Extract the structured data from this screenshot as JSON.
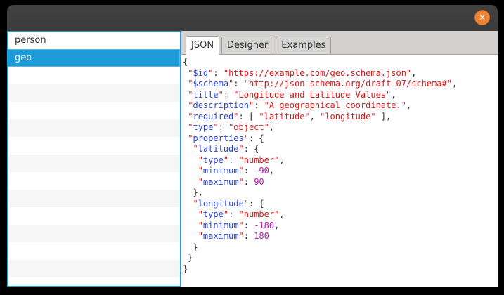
{
  "window": {
    "titlebar": {
      "title": "",
      "close_icon": "✕"
    },
    "colors": {
      "titlebar": "#3b3b3b",
      "close_button": "#ee8233",
      "background": "#000000"
    }
  },
  "sidebar": {
    "items": [
      {
        "label": "person",
        "selected": false
      },
      {
        "label": "geo",
        "selected": true
      }
    ],
    "empty_rows": 13,
    "colors": {
      "selection": "#1b9bd8",
      "focus_border": "#18a3dc",
      "stripe": "#f6f6f6"
    }
  },
  "notebook": {
    "tabs": [
      {
        "label": "JSON",
        "active": true
      },
      {
        "label": "Designer",
        "active": false
      },
      {
        "label": "Examples",
        "active": false
      }
    ]
  },
  "editor": {
    "syntax_colors": {
      "key": "#2b43d7",
      "string": "#d91717",
      "number": "#bc16bc",
      "punctuation": "#2f2f2f"
    },
    "lines": [
      [
        [
          "p",
          "{"
        ]
      ],
      [
        [
          "p",
          " "
        ],
        [
          "s",
          "\""
        ],
        [
          "k",
          "$id"
        ],
        [
          "s",
          "\""
        ],
        [
          "p",
          ": "
        ],
        [
          "s",
          "\"https://example.com/geo.schema.json\""
        ],
        [
          "p",
          ","
        ]
      ],
      [
        [
          "p",
          " "
        ],
        [
          "s",
          "\""
        ],
        [
          "k",
          "$schema"
        ],
        [
          "s",
          "\""
        ],
        [
          "p",
          ": "
        ],
        [
          "s",
          "\"http://json-schema.org/draft-07/schema#\""
        ],
        [
          "p",
          ","
        ]
      ],
      [
        [
          "p",
          " "
        ],
        [
          "s",
          "\""
        ],
        [
          "k",
          "title"
        ],
        [
          "s",
          "\""
        ],
        [
          "p",
          ": "
        ],
        [
          "s",
          "\"Longitude and Latitude Values\""
        ],
        [
          "p",
          ","
        ]
      ],
      [
        [
          "p",
          " "
        ],
        [
          "s",
          "\""
        ],
        [
          "k",
          "description"
        ],
        [
          "s",
          "\""
        ],
        [
          "p",
          ": "
        ],
        [
          "s",
          "\"A geographical coordinate.\""
        ],
        [
          "p",
          ","
        ]
      ],
      [
        [
          "p",
          " "
        ],
        [
          "s",
          "\""
        ],
        [
          "k",
          "required"
        ],
        [
          "s",
          "\""
        ],
        [
          "p",
          ": [ "
        ],
        [
          "s",
          "\"latitude\""
        ],
        [
          "p",
          ", "
        ],
        [
          "s",
          "\"longitude\""
        ],
        [
          "p",
          " ],"
        ]
      ],
      [
        [
          "p",
          " "
        ],
        [
          "s",
          "\""
        ],
        [
          "k",
          "type"
        ],
        [
          "s",
          "\""
        ],
        [
          "p",
          ": "
        ],
        [
          "s",
          "\"object\""
        ],
        [
          "p",
          ","
        ]
      ],
      [
        [
          "p",
          " "
        ],
        [
          "s",
          "\""
        ],
        [
          "k",
          "properties"
        ],
        [
          "s",
          "\""
        ],
        [
          "p",
          ": {"
        ]
      ],
      [
        [
          "p",
          "  "
        ],
        [
          "s",
          "\""
        ],
        [
          "k",
          "latitude"
        ],
        [
          "s",
          "\""
        ],
        [
          "p",
          ": {"
        ]
      ],
      [
        [
          "p",
          "   "
        ],
        [
          "s",
          "\""
        ],
        [
          "k",
          "type"
        ],
        [
          "s",
          "\""
        ],
        [
          "p",
          ": "
        ],
        [
          "s",
          "\"number\""
        ],
        [
          "p",
          ","
        ]
      ],
      [
        [
          "p",
          "   "
        ],
        [
          "s",
          "\""
        ],
        [
          "k",
          "minimum"
        ],
        [
          "s",
          "\""
        ],
        [
          "p",
          ": "
        ],
        [
          "n",
          "-90"
        ],
        [
          "p",
          ","
        ]
      ],
      [
        [
          "p",
          "   "
        ],
        [
          "s",
          "\""
        ],
        [
          "k",
          "maximum"
        ],
        [
          "s",
          "\""
        ],
        [
          "p",
          ": "
        ],
        [
          "n",
          "90"
        ]
      ],
      [
        [
          "p",
          "  },"
        ]
      ],
      [
        [
          "p",
          "  "
        ],
        [
          "s",
          "\""
        ],
        [
          "k",
          "longitude"
        ],
        [
          "s",
          "\""
        ],
        [
          "p",
          ": {"
        ]
      ],
      [
        [
          "p",
          "   "
        ],
        [
          "s",
          "\""
        ],
        [
          "k",
          "type"
        ],
        [
          "s",
          "\""
        ],
        [
          "p",
          ": "
        ],
        [
          "s",
          "\"number\""
        ],
        [
          "p",
          ","
        ]
      ],
      [
        [
          "p",
          "   "
        ],
        [
          "s",
          "\""
        ],
        [
          "k",
          "minimum"
        ],
        [
          "s",
          "\""
        ],
        [
          "p",
          ": "
        ],
        [
          "n",
          "-180"
        ],
        [
          "p",
          ","
        ]
      ],
      [
        [
          "p",
          "   "
        ],
        [
          "s",
          "\""
        ],
        [
          "k",
          "maximum"
        ],
        [
          "s",
          "\""
        ],
        [
          "p",
          ": "
        ],
        [
          "n",
          "180"
        ]
      ],
      [
        [
          "p",
          "  }"
        ]
      ],
      [
        [
          "p",
          " }"
        ]
      ],
      [
        [
          "p",
          "}"
        ]
      ]
    ]
  }
}
